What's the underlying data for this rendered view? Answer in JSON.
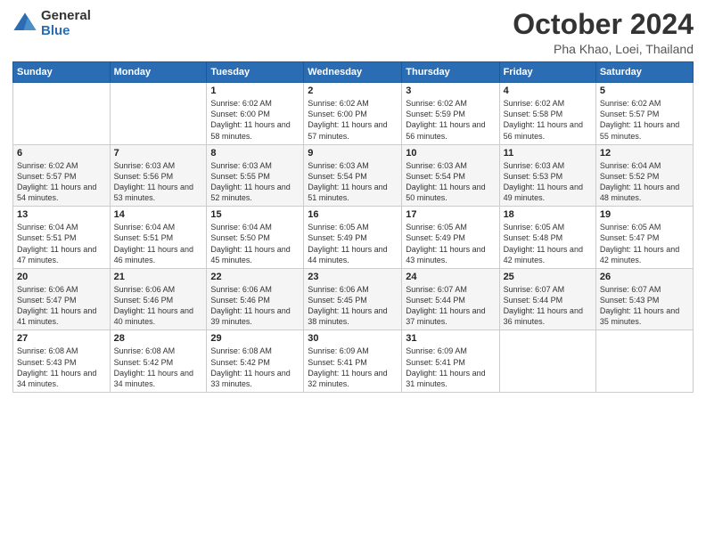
{
  "logo": {
    "general": "General",
    "blue": "Blue"
  },
  "title": "October 2024",
  "subtitle": "Pha Khao, Loei, Thailand",
  "headers": [
    "Sunday",
    "Monday",
    "Tuesday",
    "Wednesday",
    "Thursday",
    "Friday",
    "Saturday"
  ],
  "weeks": [
    [
      {
        "day": "",
        "info": ""
      },
      {
        "day": "",
        "info": ""
      },
      {
        "day": "1",
        "info": "Sunrise: 6:02 AM\nSunset: 6:00 PM\nDaylight: 11 hours and 58 minutes."
      },
      {
        "day": "2",
        "info": "Sunrise: 6:02 AM\nSunset: 6:00 PM\nDaylight: 11 hours and 57 minutes."
      },
      {
        "day": "3",
        "info": "Sunrise: 6:02 AM\nSunset: 5:59 PM\nDaylight: 11 hours and 56 minutes."
      },
      {
        "day": "4",
        "info": "Sunrise: 6:02 AM\nSunset: 5:58 PM\nDaylight: 11 hours and 56 minutes."
      },
      {
        "day": "5",
        "info": "Sunrise: 6:02 AM\nSunset: 5:57 PM\nDaylight: 11 hours and 55 minutes."
      }
    ],
    [
      {
        "day": "6",
        "info": "Sunrise: 6:02 AM\nSunset: 5:57 PM\nDaylight: 11 hours and 54 minutes."
      },
      {
        "day": "7",
        "info": "Sunrise: 6:03 AM\nSunset: 5:56 PM\nDaylight: 11 hours and 53 minutes."
      },
      {
        "day": "8",
        "info": "Sunrise: 6:03 AM\nSunset: 5:55 PM\nDaylight: 11 hours and 52 minutes."
      },
      {
        "day": "9",
        "info": "Sunrise: 6:03 AM\nSunset: 5:54 PM\nDaylight: 11 hours and 51 minutes."
      },
      {
        "day": "10",
        "info": "Sunrise: 6:03 AM\nSunset: 5:54 PM\nDaylight: 11 hours and 50 minutes."
      },
      {
        "day": "11",
        "info": "Sunrise: 6:03 AM\nSunset: 5:53 PM\nDaylight: 11 hours and 49 minutes."
      },
      {
        "day": "12",
        "info": "Sunrise: 6:04 AM\nSunset: 5:52 PM\nDaylight: 11 hours and 48 minutes."
      }
    ],
    [
      {
        "day": "13",
        "info": "Sunrise: 6:04 AM\nSunset: 5:51 PM\nDaylight: 11 hours and 47 minutes."
      },
      {
        "day": "14",
        "info": "Sunrise: 6:04 AM\nSunset: 5:51 PM\nDaylight: 11 hours and 46 minutes."
      },
      {
        "day": "15",
        "info": "Sunrise: 6:04 AM\nSunset: 5:50 PM\nDaylight: 11 hours and 45 minutes."
      },
      {
        "day": "16",
        "info": "Sunrise: 6:05 AM\nSunset: 5:49 PM\nDaylight: 11 hours and 44 minutes."
      },
      {
        "day": "17",
        "info": "Sunrise: 6:05 AM\nSunset: 5:49 PM\nDaylight: 11 hours and 43 minutes."
      },
      {
        "day": "18",
        "info": "Sunrise: 6:05 AM\nSunset: 5:48 PM\nDaylight: 11 hours and 42 minutes."
      },
      {
        "day": "19",
        "info": "Sunrise: 6:05 AM\nSunset: 5:47 PM\nDaylight: 11 hours and 42 minutes."
      }
    ],
    [
      {
        "day": "20",
        "info": "Sunrise: 6:06 AM\nSunset: 5:47 PM\nDaylight: 11 hours and 41 minutes."
      },
      {
        "day": "21",
        "info": "Sunrise: 6:06 AM\nSunset: 5:46 PM\nDaylight: 11 hours and 40 minutes."
      },
      {
        "day": "22",
        "info": "Sunrise: 6:06 AM\nSunset: 5:46 PM\nDaylight: 11 hours and 39 minutes."
      },
      {
        "day": "23",
        "info": "Sunrise: 6:06 AM\nSunset: 5:45 PM\nDaylight: 11 hours and 38 minutes."
      },
      {
        "day": "24",
        "info": "Sunrise: 6:07 AM\nSunset: 5:44 PM\nDaylight: 11 hours and 37 minutes."
      },
      {
        "day": "25",
        "info": "Sunrise: 6:07 AM\nSunset: 5:44 PM\nDaylight: 11 hours and 36 minutes."
      },
      {
        "day": "26",
        "info": "Sunrise: 6:07 AM\nSunset: 5:43 PM\nDaylight: 11 hours and 35 minutes."
      }
    ],
    [
      {
        "day": "27",
        "info": "Sunrise: 6:08 AM\nSunset: 5:43 PM\nDaylight: 11 hours and 34 minutes."
      },
      {
        "day": "28",
        "info": "Sunrise: 6:08 AM\nSunset: 5:42 PM\nDaylight: 11 hours and 34 minutes."
      },
      {
        "day": "29",
        "info": "Sunrise: 6:08 AM\nSunset: 5:42 PM\nDaylight: 11 hours and 33 minutes."
      },
      {
        "day": "30",
        "info": "Sunrise: 6:09 AM\nSunset: 5:41 PM\nDaylight: 11 hours and 32 minutes."
      },
      {
        "day": "31",
        "info": "Sunrise: 6:09 AM\nSunset: 5:41 PM\nDaylight: 11 hours and 31 minutes."
      },
      {
        "day": "",
        "info": ""
      },
      {
        "day": "",
        "info": ""
      }
    ]
  ]
}
